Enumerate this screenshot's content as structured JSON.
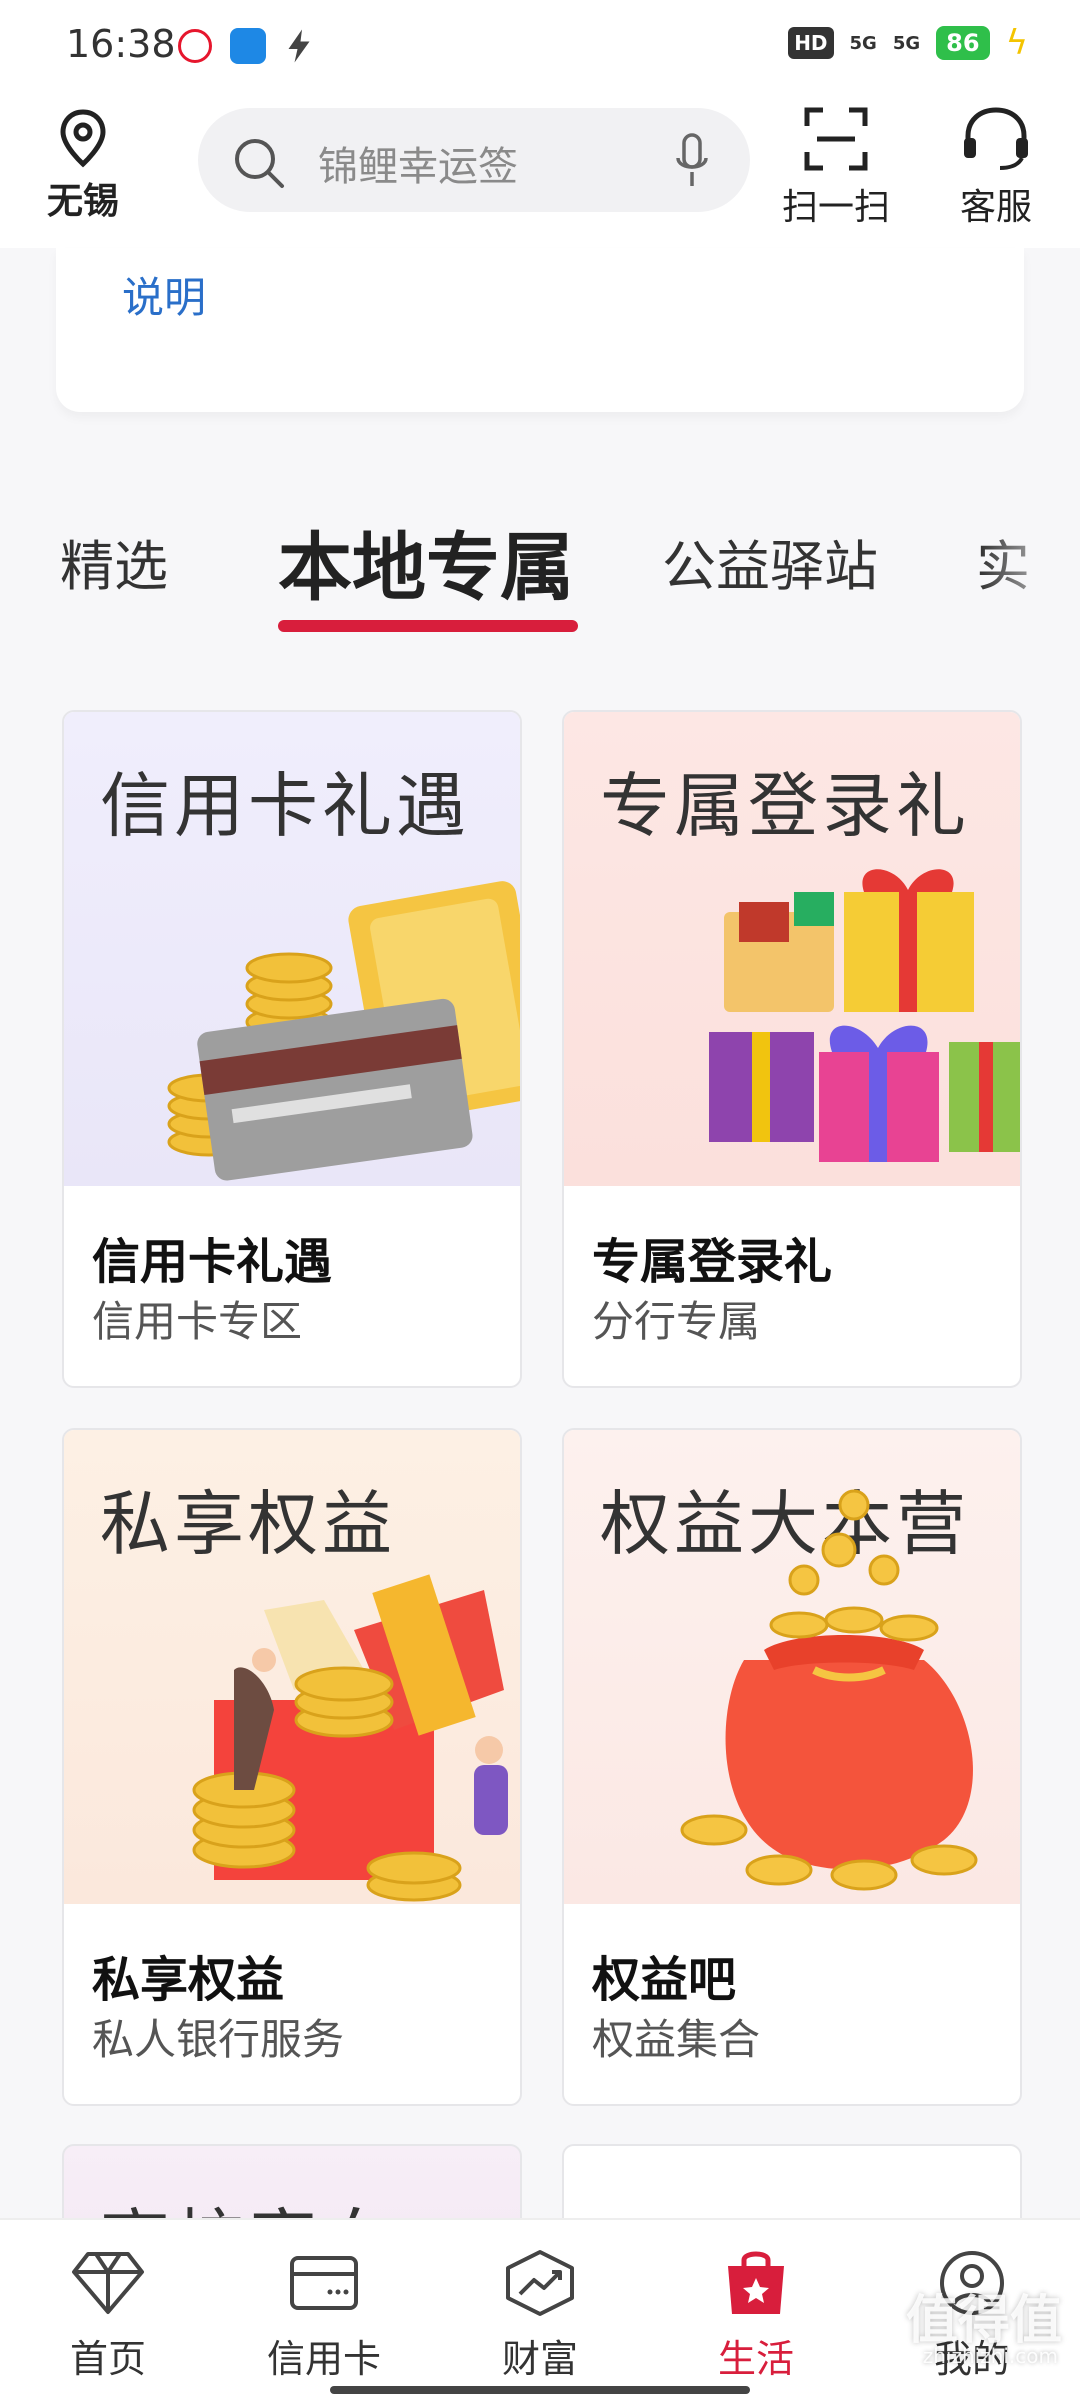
{
  "status_bar": {
    "time": "16:38",
    "network_1": "5G",
    "network_2": "5G",
    "battery": "86",
    "icons": [
      "weibo-icon",
      "e-app-icon",
      "bolt-icon",
      "hd-icon",
      "signal-icon",
      "battery-icon",
      "charging-icon"
    ]
  },
  "header": {
    "location": "无锡",
    "search_placeholder": "锦鲤幸运签",
    "scan_label": "扫一扫",
    "service_label": "客服"
  },
  "explain_card": {
    "link": "说明"
  },
  "tabs": [
    {
      "label": "精选"
    },
    {
      "label": "本地专属"
    },
    {
      "label": "公益驿站"
    },
    {
      "label": "实"
    }
  ],
  "active_tab": "本地专属",
  "cards": [
    {
      "art_title": "信用卡礼遇",
      "title": "信用卡礼遇",
      "subtitle": "信用卡专区"
    },
    {
      "art_title": "专属登录礼",
      "title": "专属登录礼",
      "subtitle": "分行专属"
    },
    {
      "art_title": "私享权益",
      "title": "私享权益",
      "subtitle": "私人银行服务"
    },
    {
      "art_title": "权益大本营",
      "title": "权益吧",
      "subtitle": "权益集合"
    }
  ],
  "peek_cards": [
    {
      "art_title": "高校宿白"
    },
    {
      "art_title": ""
    }
  ],
  "bottom_nav": [
    {
      "label": "首页",
      "icon": "diamond-icon"
    },
    {
      "label": "信用卡",
      "icon": "credit-card-icon"
    },
    {
      "label": "财富",
      "icon": "wealth-chart-icon"
    },
    {
      "label": "生活",
      "icon": "shopping-bag-icon"
    },
    {
      "label": "我的",
      "icon": "user-icon"
    }
  ],
  "active_nav": "生活",
  "watermark": {
    "main": "值得值",
    "sub": "zhizhizhi.com"
  },
  "colors": {
    "accent": "#d81e3c",
    "link": "#2a6fc9"
  }
}
